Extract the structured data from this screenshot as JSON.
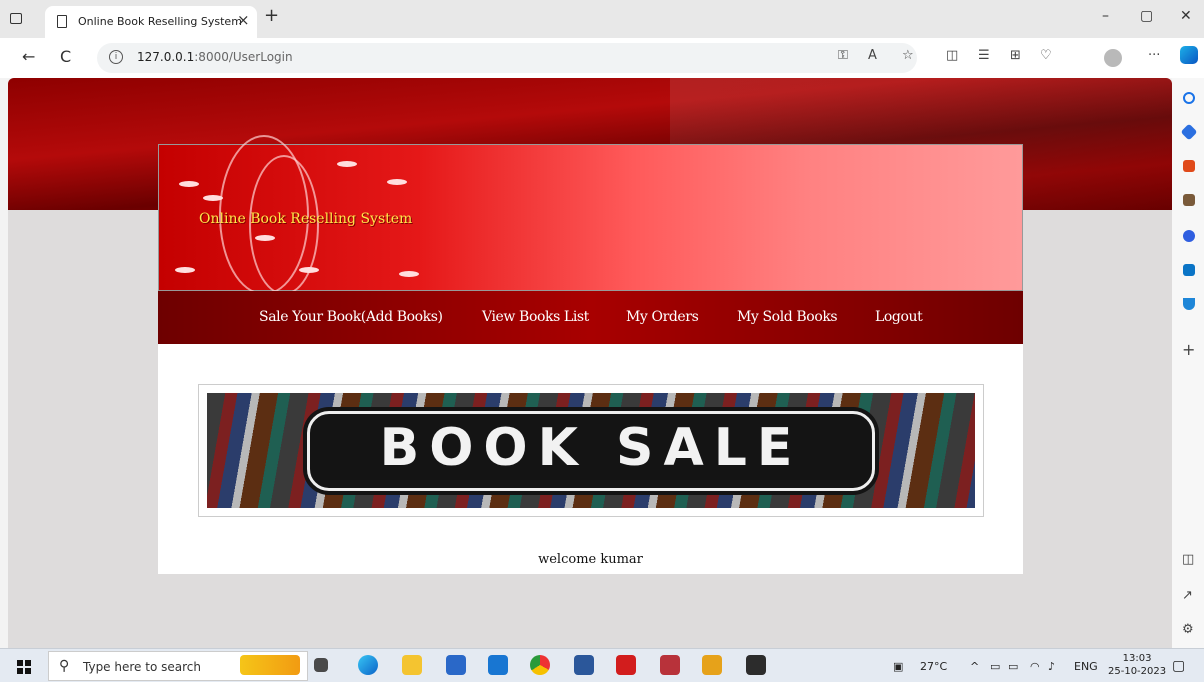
{
  "browser": {
    "tab_title": "Online Book Reselling System",
    "tab_close": "×",
    "new_tab": "+",
    "url_host": "127.0.0.1",
    "url_rest": ":8000/UserLogin",
    "window_min": "–",
    "window_restore": "▢",
    "window_close": "✕",
    "back": "←",
    "reload": "C",
    "more": "···"
  },
  "site": {
    "title": "Online Book Reselling System",
    "menu": [
      {
        "label": "Sale Your Book(Add Books)"
      },
      {
        "label": "View Books List"
      },
      {
        "label": "My Orders"
      },
      {
        "label": "My Sold Books"
      },
      {
        "label": "Logout"
      }
    ],
    "banner_text": "BOOK SALE",
    "welcome": "welcome kumar"
  },
  "taskbar": {
    "search_placeholder": "Type here to search",
    "weather": "27°C",
    "language": "ENG",
    "time": "13:03",
    "date": "25-10-2023"
  },
  "colors": {
    "hero_red": "#a00000",
    "title_yellow": "#ffe64a",
    "menu_red": "#8e0000"
  }
}
